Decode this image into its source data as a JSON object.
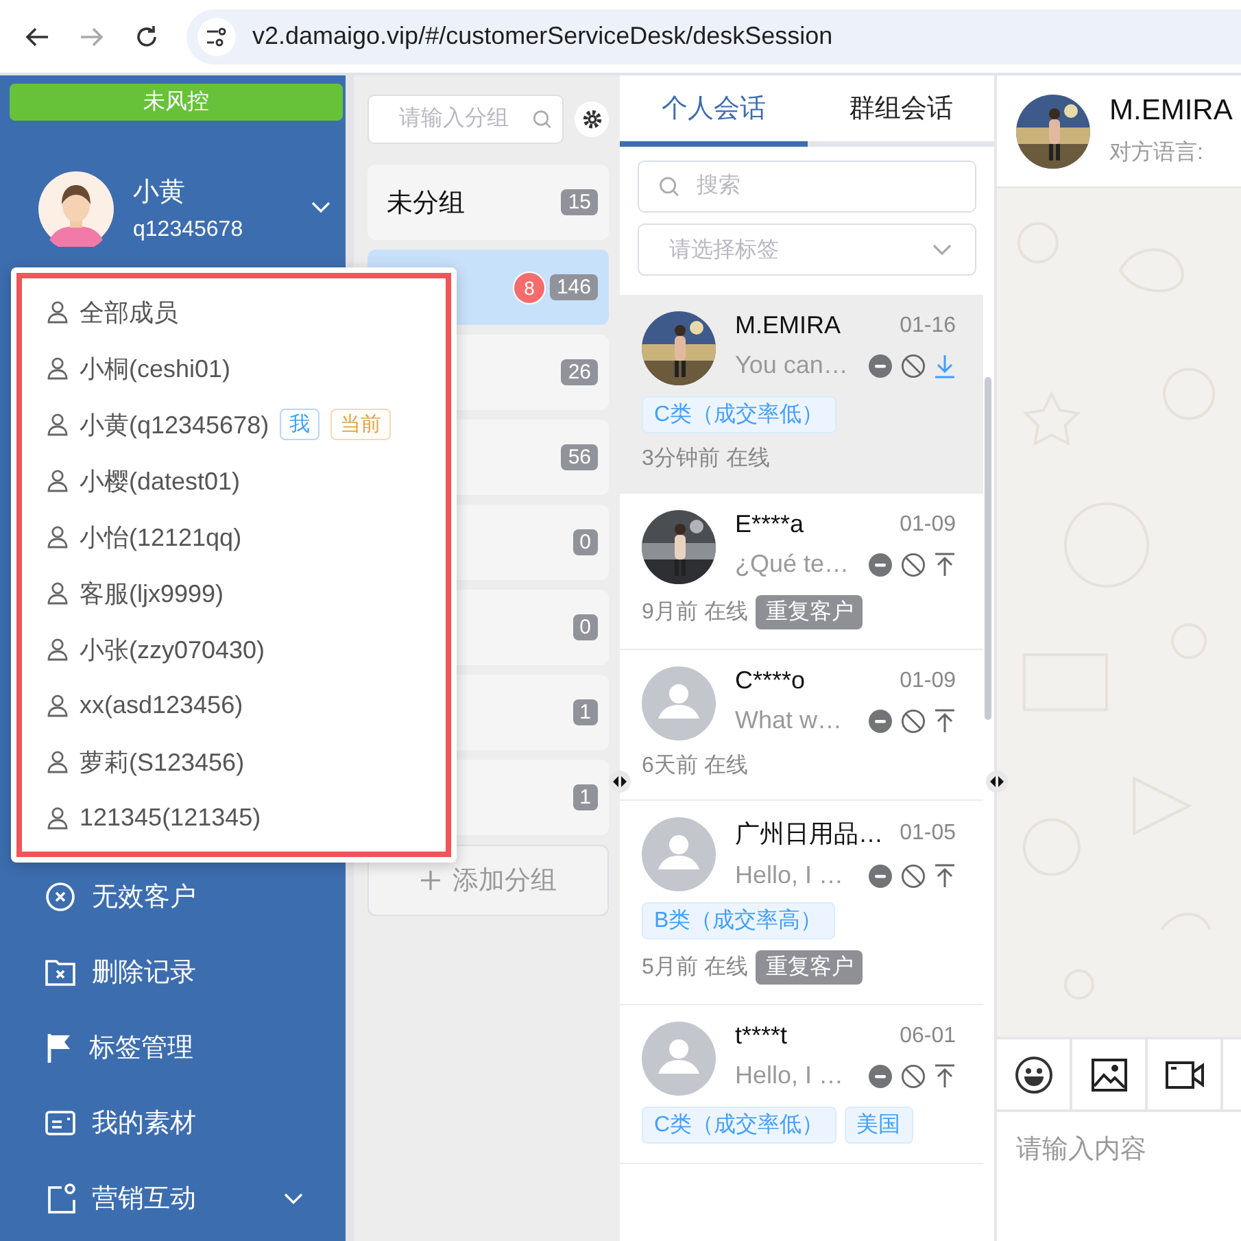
{
  "browser": {
    "url": "v2.damaigo.vip/#/customerServiceDesk/deskSession"
  },
  "sidebar": {
    "risk_banner": "未风控",
    "user": {
      "name": "小黄",
      "account": "q12345678"
    },
    "nav": [
      {
        "label": "无效客户",
        "kind": "link"
      },
      {
        "label": "删除记录",
        "kind": "link"
      },
      {
        "label": "标签管理",
        "kind": "link"
      },
      {
        "label": "我的素材",
        "kind": "link"
      },
      {
        "label": "营销互动",
        "kind": "submenu"
      }
    ]
  },
  "member_menu": [
    {
      "label": "全部成员"
    },
    {
      "label": "小桐(ceshi01)"
    },
    {
      "label": "小黄(q12345678)",
      "badges": [
        {
          "label": "我",
          "kind": "self"
        },
        {
          "label": "当前",
          "kind": "current"
        }
      ]
    },
    {
      "label": "小樱(datest01)"
    },
    {
      "label": "小怡(12121qq)"
    },
    {
      "label": "客服(ljx9999)"
    },
    {
      "label": "小张(zzy070430)"
    },
    {
      "label": "xx(asd123456)"
    },
    {
      "label": "萝莉(S123456)"
    },
    {
      "label": "121345(121345)"
    }
  ],
  "groups": {
    "search": {
      "placeholder": "请输入分组"
    },
    "items": [
      {
        "label": "未分组",
        "count": "15",
        "selected": false
      },
      {
        "count": "146",
        "unread": "8",
        "selected": true
      },
      {
        "count": "26",
        "selected": false
      },
      {
        "count": "56",
        "selected": false
      },
      {
        "count": "0",
        "selected": false
      },
      {
        "count": "0",
        "selected": false
      },
      {
        "count": "1",
        "selected": false
      },
      {
        "count": "1",
        "selected": false
      }
    ],
    "add_button": "添加分组"
  },
  "sessions": {
    "tabs": [
      {
        "label": "个人会话",
        "selected": true
      },
      {
        "label": "群组会话",
        "selected": false
      }
    ],
    "search": {
      "placeholder": "搜索"
    },
    "tag_select": {
      "placeholder": "请选择标签"
    },
    "items": [
      {
        "name": "M.EMIRA",
        "date": "01-16",
        "preview": "You can…",
        "has_photo": true,
        "synced": true,
        "tags": [
          {
            "label": "C类（成交率低）",
            "kind": "category"
          }
        ],
        "status": "3分钟前 在线",
        "selected": true
      },
      {
        "name": "E****a",
        "date": "01-09",
        "preview": "¿Qué te…",
        "has_photo": true,
        "synced": false,
        "status": "9月前 在线",
        "badges": [
          "重复客户"
        ],
        "selected": false
      },
      {
        "name": "C****o",
        "date": "01-09",
        "preview": "What w…",
        "has_photo": false,
        "synced": false,
        "status": "6天前 在线",
        "selected": false
      },
      {
        "name": "广州日用品…",
        "date": "01-05",
        "preview": "Hello, I …",
        "has_photo": false,
        "synced": false,
        "tags": [
          {
            "label": "B类（成交率高）",
            "kind": "category"
          }
        ],
        "status": "5月前 在线",
        "badges": [
          "重复客户"
        ],
        "selected": false
      },
      {
        "name": "t****t",
        "date": "06-01",
        "preview": "Hello, I …",
        "has_photo": false,
        "synced": false,
        "tags": [
          {
            "label": "C类（成交率低）",
            "kind": "category"
          },
          {
            "label": "美国",
            "kind": "category"
          }
        ],
        "selected": false
      }
    ]
  },
  "chat": {
    "name": "M.EMIRA",
    "language_label": "对方语言:",
    "input": {
      "placeholder": "请输入内容"
    }
  }
}
